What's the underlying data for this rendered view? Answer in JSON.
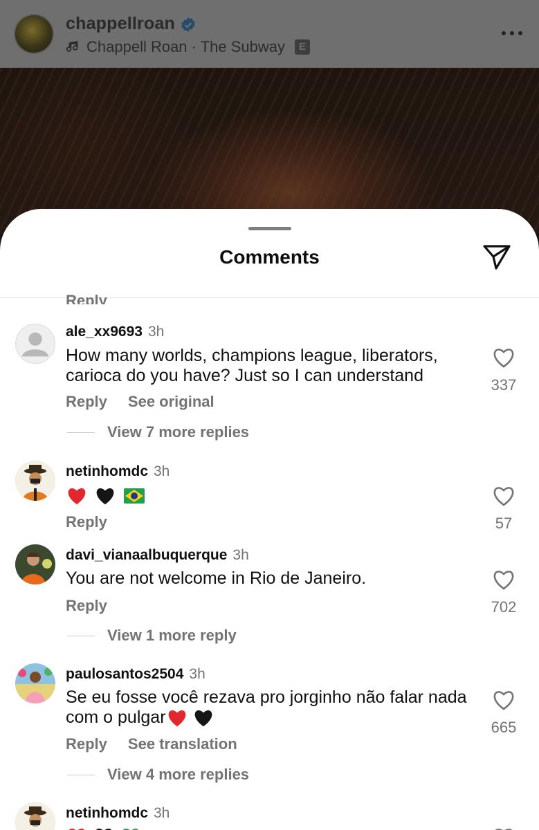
{
  "post": {
    "username": "chappellroan",
    "music": "Chappell Roan · The Subway",
    "explicit_badge": "E"
  },
  "sheet": {
    "title": "Comments",
    "cut_reply": "Reply"
  },
  "comments": [
    {
      "username": "ale_xx9693",
      "time": "3h",
      "text": "How many worlds, champions league, liberators, carioca do you have? Just so I can understand",
      "actions": [
        "Reply",
        "See original"
      ],
      "likes": "337",
      "view_replies": "View 7 more replies",
      "avatar": "default-avatar-icon"
    },
    {
      "username": "netinhomdc",
      "time": "3h",
      "text": "",
      "emojis": [
        "red-heart",
        "black-heart",
        "brazil-flag"
      ],
      "actions": [
        "Reply"
      ],
      "likes": "57",
      "view_replies": "",
      "avatar": "cartoon-avatar"
    },
    {
      "username": "davi_vianaalbuquerque",
      "time": "3h",
      "text": "You are not welcome in Rio de Janeiro.",
      "actions": [
        "Reply"
      ],
      "likes": "702",
      "view_replies": "View 1 more reply",
      "avatar": "photo-avatar"
    },
    {
      "username": "paulosantos2504",
      "time": "3h",
      "text": "Se eu fosse você rezava pro jorginho não falar nada com o pulgar",
      "emojis": [
        "red-heart",
        "black-heart"
      ],
      "actions": [
        "Reply",
        "See translation"
      ],
      "likes": "665",
      "view_replies": "View 4 more replies",
      "avatar": "photo-avatar"
    },
    {
      "username": "netinhomdc",
      "time": "3h",
      "text": "",
      "emojis": [
        "red-heart",
        "black-heart",
        "green-heart"
      ],
      "actions": [],
      "likes": "",
      "view_replies": "",
      "avatar": "cartoon-avatar"
    }
  ],
  "colors": {
    "text_primary": "#111111",
    "text_secondary": "#737373",
    "verified_blue": "#0095f6",
    "dim_overlay": "#6f6f6f"
  }
}
